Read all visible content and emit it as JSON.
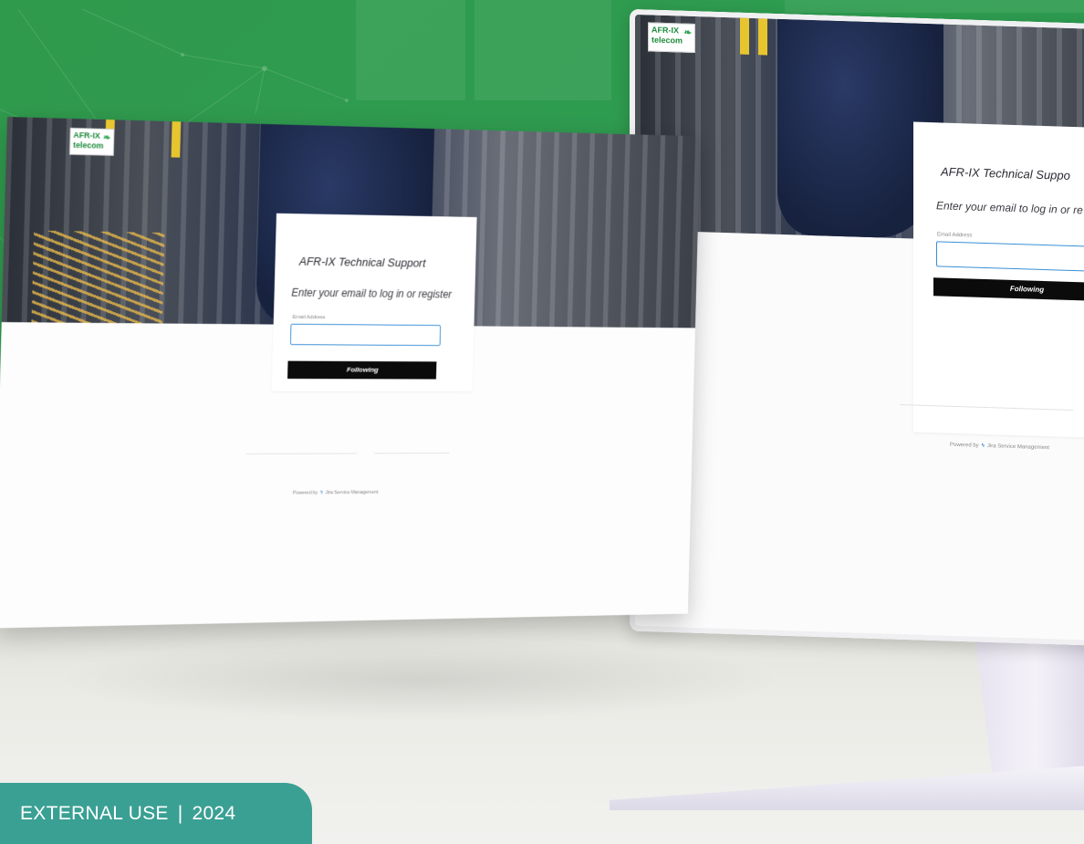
{
  "brand": {
    "logo_line1": "AFR-IX",
    "logo_line2": "telecom",
    "accent_green": "#2e9c50",
    "teal": "#3aa093"
  },
  "login_card": {
    "title": "AFR-IX Technical Support",
    "subtitle": "Enter your email to log in or register",
    "email_label": "Email Address",
    "email_value": "",
    "button_label": "Following",
    "powered_prefix": "Powered by",
    "powered_product": "Jira Service Management"
  },
  "back_card": {
    "title": "AFR-IX Technical Suppo",
    "subtitle": "Enter your email to log in or re",
    "email_label": "Email Address",
    "button_label": "Following",
    "powered_prefix": "Powered by",
    "powered_product": "Jira Service Management"
  },
  "footer_tag": {
    "left": "EXTERNAL USE",
    "separator": "|",
    "right": "2024"
  }
}
